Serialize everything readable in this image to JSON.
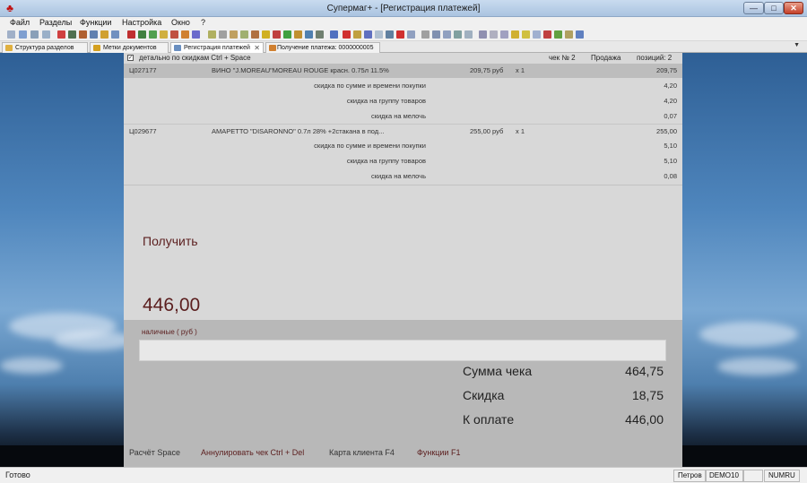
{
  "window": {
    "title": "Супермаг+  - [Регистрация платежей]",
    "minimize": "—",
    "maximize": "□",
    "close": "✕"
  },
  "menu": [
    "Файл",
    "Разделы",
    "Функции",
    "Настройка",
    "Окно",
    "?"
  ],
  "tabs": [
    {
      "label": "Структура разделов",
      "icon_color": "#e0b040"
    },
    {
      "label": "Метки документов",
      "icon_color": "#d4a020"
    },
    {
      "label": "Регистрация платежей",
      "icon_color": "#6a8fc0",
      "active": true,
      "close": "✕"
    },
    {
      "label": "Получение платежа: 0000000005",
      "icon_color": "#d08030"
    }
  ],
  "tab_dropdown": "▼",
  "receipt": {
    "detail_checkbox": "✓",
    "detail_label": "детально по скидкам Ctrl + Space",
    "check_no": "чек №  2",
    "op_type": "Продажа",
    "positions": "позиций:  2",
    "items": [
      {
        "code": "Ц027177",
        "name": "ВИНО \"J.MOREAU\"MOREAU ROUGE красн. 0.75л 11.5%",
        "price": "209,75 руб",
        "qty": "x 1",
        "sum": "209,75",
        "discounts": [
          {
            "label": "скидка по сумме и времени покупки",
            "value": "4,20"
          },
          {
            "label": "скидка на группу товаров",
            "value": "4,20"
          },
          {
            "label": "скидка на мелочь",
            "value": "0,07"
          }
        ]
      },
      {
        "code": "Ц029677",
        "name": "АМАРЕТТО \"DISARONNO\"  0.7л 28% +2стакана в под...",
        "price": "255,00 руб",
        "qty": "x 1",
        "sum": "255,00",
        "discounts": [
          {
            "label": "скидка по сумме и времени покупки",
            "value": "5,10"
          },
          {
            "label": "скидка на группу товаров",
            "value": "5,10"
          },
          {
            "label": "скидка на мелочь",
            "value": "0,08"
          }
        ]
      }
    ]
  },
  "payment": {
    "receive_label": "Получить",
    "receive_amount": "446,00",
    "method_label": "наличные ( руб )",
    "input_value": "",
    "summary": [
      {
        "label": "Сумма чека",
        "value": "464,75"
      },
      {
        "label": "Скидка",
        "value": "18,75"
      },
      {
        "label": "К оплате",
        "value": "446,00"
      }
    ]
  },
  "hotkeys": {
    "calc": "Расчёт Space",
    "cancel": "Аннулировать чек Ctrl + Del",
    "card": "Карта клиента F4",
    "functions": "Функции F1"
  },
  "statusbar": {
    "ready": "Готово",
    "user": "Петров",
    "db": "DEMO10",
    "empty": "",
    "keys": "NUMRU"
  },
  "colors": {
    "accent_text": "#5b1e1e",
    "panel_bg": "#d8d8d8",
    "lower_bg": "#b8b8b8",
    "selected_row": "#bdbdbd"
  }
}
